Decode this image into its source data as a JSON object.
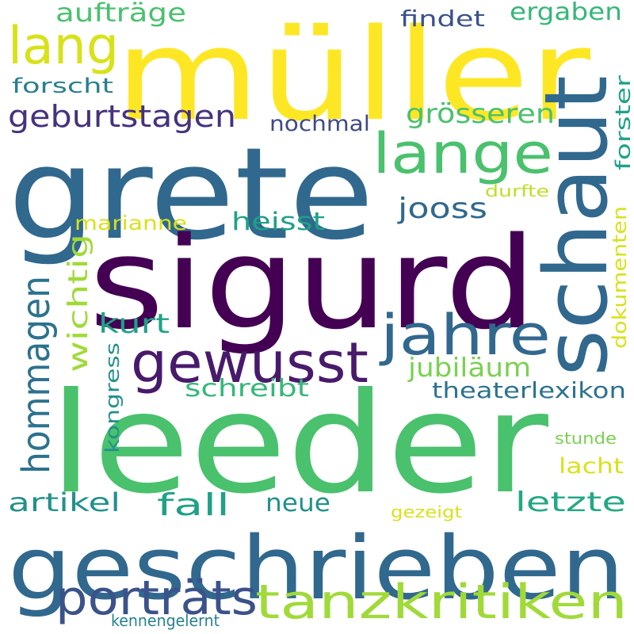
{
  "colors": {
    "background": "#ffffff",
    "yellow": "#fde725",
    "lime": "#a0da39",
    "green": "#4ac16d",
    "teal": "#1fa187",
    "teal_blue": "#277f8e",
    "blue": "#365c8d",
    "indigo": "#46327e",
    "purple": "#440154"
  },
  "words": [
    {
      "text": "müller",
      "color": "#fde725",
      "vertical": false
    },
    {
      "text": "grete",
      "color": "#31688e",
      "vertical": false
    },
    {
      "text": "sigurd",
      "color": "#440154",
      "vertical": false
    },
    {
      "text": "leeder",
      "color": "#4ac16d",
      "vertical": false
    },
    {
      "text": "geschrieben",
      "color": "#31688e",
      "vertical": false
    },
    {
      "text": "schaut",
      "color": "#31688e",
      "vertical": true
    },
    {
      "text": "lang",
      "color": "#d8e219",
      "vertical": false
    },
    {
      "text": "lange",
      "color": "#4ac16d",
      "vertical": false
    },
    {
      "text": "gewusst",
      "color": "#481a6c",
      "vertical": false
    },
    {
      "text": "jahre",
      "color": "#31688e",
      "vertical": false
    },
    {
      "text": "hommagen",
      "color": "#2c728e",
      "vertical": true
    },
    {
      "text": "porträts",
      "color": "#3b528b",
      "vertical": false
    },
    {
      "text": "tanzkritiken",
      "color": "#a0da39",
      "vertical": false
    },
    {
      "text": "aufträge",
      "color": "#4ac16d",
      "vertical": false
    },
    {
      "text": "findet",
      "color": "#3b528b",
      "vertical": false
    },
    {
      "text": "ergaben",
      "color": "#35b779",
      "vertical": false
    },
    {
      "text": "forscht",
      "color": "#277f8e",
      "vertical": false
    },
    {
      "text": "geburtstagen",
      "color": "#46327e",
      "vertical": false
    },
    {
      "text": "grösseren",
      "color": "#4ac16d",
      "vertical": false
    },
    {
      "text": "nochmal",
      "color": "#3e4989",
      "vertical": false
    },
    {
      "text": "forster",
      "color": "#1fa187",
      "vertical": true
    },
    {
      "text": "jooss",
      "color": "#31688e",
      "vertical": false
    },
    {
      "text": "durfte",
      "color": "#bddf26",
      "vertical": false
    },
    {
      "text": "marianne",
      "color": "#d8e219",
      "vertical": false
    },
    {
      "text": "heisst",
      "color": "#1fa187",
      "vertical": false
    },
    {
      "text": "wichtig",
      "color": "#a0da39",
      "vertical": true
    },
    {
      "text": "kurt",
      "color": "#1fa187",
      "vertical": false
    },
    {
      "text": "dokumenten",
      "color": "#d8e219",
      "vertical": true
    },
    {
      "text": "jubiläum",
      "color": "#7ad151",
      "vertical": false
    },
    {
      "text": "schreibt",
      "color": "#35b779",
      "vertical": false
    },
    {
      "text": "theaterlexikon",
      "color": "#2c728e",
      "vertical": false
    },
    {
      "text": "kongress",
      "color": "#21918c",
      "vertical": true
    },
    {
      "text": "stunde",
      "color": "#7ad151",
      "vertical": false
    },
    {
      "text": "lacht",
      "color": "#d8e219",
      "vertical": false
    },
    {
      "text": "artikel",
      "color": "#21918c",
      "vertical": false
    },
    {
      "text": "fall",
      "color": "#1fa187",
      "vertical": false
    },
    {
      "text": "neue",
      "color": "#21918c",
      "vertical": false
    },
    {
      "text": "letzte",
      "color": "#22a884",
      "vertical": false
    },
    {
      "text": "gezeigt",
      "color": "#d8e219",
      "vertical": false
    },
    {
      "text": "kennengelernt",
      "color": "#26828e",
      "vertical": false
    }
  ]
}
